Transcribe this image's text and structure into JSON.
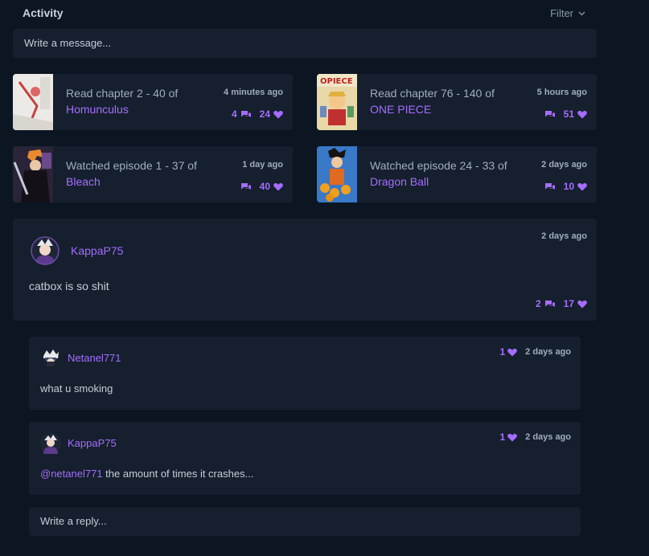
{
  "header": {
    "title": "Activity",
    "filter_label": "Filter"
  },
  "composer": {
    "placeholder": "Write a message..."
  },
  "activities": [
    {
      "action": "Read chapter 2 - 40 of",
      "title": "Homunculus",
      "time": "4 minutes ago",
      "replies": "4",
      "likes": "24",
      "cover_icon": "homunculus-cover"
    },
    {
      "action": "Read chapter 76 - 140 of",
      "title": "ONE PIECE",
      "time": "5 hours ago",
      "replies": "",
      "likes": "51",
      "cover_icon": "one-piece-cover"
    },
    {
      "action": "Watched episode 1 - 37 of",
      "title": "Bleach",
      "time": "1 day ago",
      "replies": "",
      "likes": "40",
      "cover_icon": "bleach-cover"
    },
    {
      "action": "Watched episode 24 - 33 of",
      "title": "Dragon Ball",
      "time": "2 days ago",
      "replies": "",
      "likes": "10",
      "cover_icon": "dragon-ball-cover"
    }
  ],
  "post": {
    "user": "KappaP75",
    "time": "2 days ago",
    "body": "catbox is so shit",
    "replies": "2",
    "likes": "17"
  },
  "replies": [
    {
      "user": "Netanel771",
      "likes": "1",
      "time": "2 days ago",
      "mention": "",
      "body": "what u smoking"
    },
    {
      "user": "KappaP75",
      "likes": "1",
      "time": "2 days ago",
      "mention": "@netanel771",
      "body": " the amount of times it crashes..."
    }
  ],
  "reply_box": {
    "placeholder": "Write a reply..."
  },
  "colors": {
    "background": "#0b1622",
    "card": "#151f2e",
    "accent": "#a66cff",
    "text": "#9fadbd"
  }
}
